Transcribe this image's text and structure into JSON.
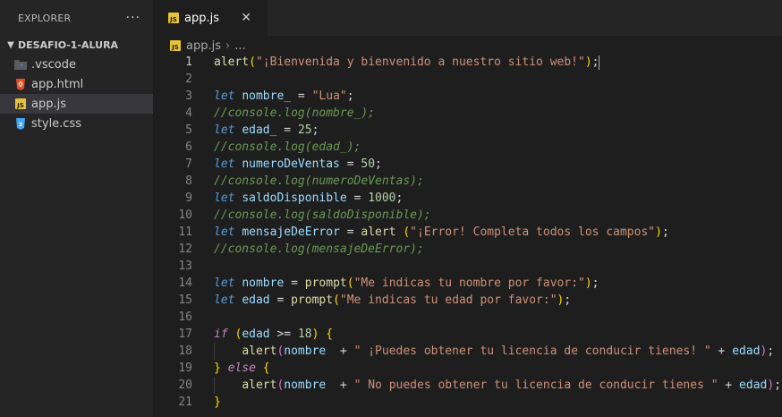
{
  "sidebar": {
    "title": "EXPLORER",
    "more_label": "···",
    "folder": "DESAFIO-1-ALURA",
    "files": [
      {
        "name": ".vscode",
        "icon": "vscode-folder-icon",
        "color": "#3c78c8"
      },
      {
        "name": "app.html",
        "icon": "html-file-icon",
        "color": "#e44d26"
      },
      {
        "name": "app.js",
        "icon": "js-file-icon",
        "color": "#e8c33a",
        "active": true
      },
      {
        "name": "style.css",
        "icon": "css-file-icon",
        "color": "#42a5f5"
      }
    ]
  },
  "tab": {
    "label": "app.js",
    "close": "✕"
  },
  "breadcrumb": {
    "file": "app.js",
    "sep": "›",
    "more": "..."
  },
  "editor": {
    "active_line": 1,
    "lines": [
      {
        "n": "1",
        "tokens": [
          [
            "fn",
            "alert"
          ],
          [
            "br1",
            "("
          ],
          [
            "str",
            "\"¡Bienvenida y bienvenido a nuestro sitio web!\""
          ],
          [
            "br1",
            ")"
          ],
          [
            "op",
            ";"
          ]
        ]
      },
      {
        "n": "2",
        "tokens": []
      },
      {
        "n": "3",
        "tokens": [
          [
            "kw",
            "let"
          ],
          [
            "op",
            " "
          ],
          [
            "var",
            "nombre_"
          ],
          [
            "op",
            " = "
          ],
          [
            "str",
            "\"Lua\""
          ],
          [
            "op",
            ";"
          ]
        ]
      },
      {
        "n": "4",
        "tokens": [
          [
            "com",
            "//console.log(nombre_);"
          ]
        ]
      },
      {
        "n": "5",
        "tokens": [
          [
            "kw",
            "let"
          ],
          [
            "op",
            " "
          ],
          [
            "var",
            "edad_"
          ],
          [
            "op",
            " = "
          ],
          [
            "num",
            "25"
          ],
          [
            "op",
            ";"
          ]
        ]
      },
      {
        "n": "6",
        "tokens": [
          [
            "com",
            "//console.log(edad_);"
          ]
        ]
      },
      {
        "n": "7",
        "tokens": [
          [
            "kw",
            "let"
          ],
          [
            "op",
            " "
          ],
          [
            "var",
            "numeroDeVentas"
          ],
          [
            "op",
            " = "
          ],
          [
            "num",
            "50"
          ],
          [
            "op",
            ";"
          ]
        ]
      },
      {
        "n": "8",
        "tokens": [
          [
            "com",
            "//console.log(numeroDeVentas);"
          ]
        ]
      },
      {
        "n": "9",
        "tokens": [
          [
            "kw",
            "let"
          ],
          [
            "op",
            " "
          ],
          [
            "var",
            "saldoDisponible"
          ],
          [
            "op",
            " = "
          ],
          [
            "num",
            "1000"
          ],
          [
            "op",
            ";"
          ]
        ]
      },
      {
        "n": "10",
        "tokens": [
          [
            "com",
            "//console.log(saldoDisponible);"
          ]
        ]
      },
      {
        "n": "11",
        "tokens": [
          [
            "kw",
            "let"
          ],
          [
            "op",
            " "
          ],
          [
            "var",
            "mensajeDeError"
          ],
          [
            "op",
            " = "
          ],
          [
            "fn",
            "alert"
          ],
          [
            "op",
            " "
          ],
          [
            "br1",
            "("
          ],
          [
            "str",
            "\"¡Error! Completa todos los campos\""
          ],
          [
            "br1",
            ")"
          ],
          [
            "op",
            ";"
          ]
        ]
      },
      {
        "n": "12",
        "tokens": [
          [
            "com",
            "//console.log(mensajeDeError);"
          ]
        ]
      },
      {
        "n": "13",
        "tokens": []
      },
      {
        "n": "14",
        "tokens": [
          [
            "kw",
            "let"
          ],
          [
            "op",
            " "
          ],
          [
            "var",
            "nombre"
          ],
          [
            "op",
            " = "
          ],
          [
            "fn",
            "prompt"
          ],
          [
            "br1",
            "("
          ],
          [
            "str",
            "\"Me indicas tu nombre por favor:\""
          ],
          [
            "br1",
            ")"
          ],
          [
            "op",
            ";"
          ]
        ]
      },
      {
        "n": "15",
        "tokens": [
          [
            "kw",
            "let"
          ],
          [
            "op",
            " "
          ],
          [
            "var",
            "edad"
          ],
          [
            "op",
            " = "
          ],
          [
            "fn",
            "prompt"
          ],
          [
            "br1",
            "("
          ],
          [
            "str",
            "\"Me indicas tu edad por favor:\""
          ],
          [
            "br1",
            ")"
          ],
          [
            "op",
            ";"
          ]
        ]
      },
      {
        "n": "16",
        "tokens": []
      },
      {
        "n": "17",
        "tokens": [
          [
            "ctl",
            "if"
          ],
          [
            "op",
            " "
          ],
          [
            "br1",
            "("
          ],
          [
            "var",
            "edad"
          ],
          [
            "op",
            " >= "
          ],
          [
            "num",
            "18"
          ],
          [
            "br1",
            ")"
          ],
          [
            "op",
            " "
          ],
          [
            "br1",
            "{"
          ]
        ]
      },
      {
        "n": "18",
        "tokens": [
          [
            "op",
            "    "
          ],
          [
            "fn",
            "alert"
          ],
          [
            "br2",
            "("
          ],
          [
            "var",
            "nombre"
          ],
          [
            "op",
            "  + "
          ],
          [
            "str",
            "\" ¡Puedes obtener tu licencia de conducir tienes! \""
          ],
          [
            "op",
            " + "
          ],
          [
            "var",
            "edad"
          ],
          [
            "br2",
            ")"
          ],
          [
            "op",
            ";"
          ]
        ]
      },
      {
        "n": "19",
        "tokens": [
          [
            "br1",
            "}"
          ],
          [
            "op",
            " "
          ],
          [
            "ctl",
            "else"
          ],
          [
            "op",
            " "
          ],
          [
            "br1",
            "{"
          ]
        ]
      },
      {
        "n": "20",
        "tokens": [
          [
            "op",
            "    "
          ],
          [
            "fn",
            "alert"
          ],
          [
            "br2",
            "("
          ],
          [
            "var",
            "nombre"
          ],
          [
            "op",
            "  + "
          ],
          [
            "str",
            "\" No puedes obtener tu licencia de conducir tienes \""
          ],
          [
            "op",
            " + "
          ],
          [
            "var",
            "edad"
          ],
          [
            "br2",
            ")"
          ],
          [
            "op",
            ";"
          ]
        ]
      },
      {
        "n": "21",
        "tokens": [
          [
            "br1",
            "}"
          ]
        ]
      }
    ]
  },
  "colors": {
    "background": "#1e1e1e",
    "sidebar": "#252526",
    "function": "#dcdcaa",
    "string": "#ce9178",
    "number": "#b5cea8",
    "keyword": "#569cd6",
    "control": "#c586c0",
    "variable": "#9cdcfe",
    "comment": "#6a9955"
  }
}
